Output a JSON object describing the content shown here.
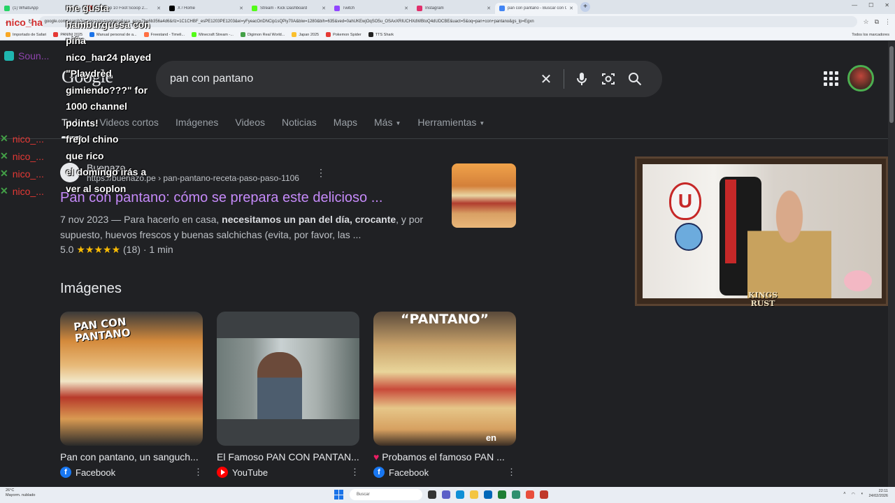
{
  "browser": {
    "tabs": [
      {
        "label": "(1) WhatsApp",
        "color": "#25d366"
      },
      {
        "label": "SNG Top 10 Foot Scoop 2...",
        "color": "#e53935"
      },
      {
        "label": "X / Home",
        "color": "#000000"
      },
      {
        "label": "Stream - Kick Dashboard",
        "color": "#53fc18"
      },
      {
        "label": "Twitch",
        "color": "#9146ff"
      },
      {
        "label": "Instagram",
        "color": "#e1306c"
      },
      {
        "label": "pan con pantano - Buscar con G",
        "color": "#4285f4",
        "active": true
      }
    ],
    "url": "google.com/search?q=pan+con+pantano&sca_esv=7be6b356a4d6&rlz=1C1CHBF_esPE1203PE1203&ei=yFyeacOnDNCip1sQPiy70A&biw=1280&bih=635&ved=0ahUKEwjOqSO5u_OSAxXRIUCHXdWBtoQ4dUDCBE&uact=5&oq=pan+con+pantano&gs_lp=Egxn",
    "bookmarks": [
      {
        "label": "Importado de Safari",
        "color": "#f9a825"
      },
      {
        "label": "PANINI 2025",
        "color": "#e53935"
      },
      {
        "label": "Manual personal de a...",
        "color": "#1a73e8"
      },
      {
        "label": "Freestand - Timeli...",
        "color": "#ff7043"
      },
      {
        "label": "Minecraft Stream -...",
        "color": "#53fc18"
      },
      {
        "label": "Digimon Real World...",
        "color": "#43a047"
      },
      {
        "label": "Japan 2025",
        "color": "#fbc02d"
      },
      {
        "label": "Pokemon Spider",
        "color": "#e53935"
      },
      {
        "label": "TTS Shark",
        "color": "#212121"
      }
    ],
    "all_bookmarks": "Todos los marcadores"
  },
  "google": {
    "logo": "Google",
    "query": "pan con pantano",
    "tabs": [
      {
        "label": "Todo",
        "active": true
      },
      {
        "label": "Videos cortos"
      },
      {
        "label": "Imágenes"
      },
      {
        "label": "Videos"
      },
      {
        "label": "Noticias"
      },
      {
        "label": "Maps"
      },
      {
        "label": "Más",
        "dropdown": true
      },
      {
        "label": "Herramientas",
        "dropdown": true
      }
    ],
    "result": {
      "site": "Buenazo",
      "url": "https://buenazo.pe › pan-pantano-receta-paso-paso-1106",
      "title": "Pan con pantano: cómo se prepara este delicioso ...",
      "date": "7 nov 2023",
      "snippet_pre": " — Para hacerlo en casa, ",
      "snippet_bold": "necesitamos un pan del día, crocante",
      "snippet_post": ", y por supuesto, huevos frescos y buenas salchichas (evita, por favor, las ...",
      "rating": "5.0",
      "stars": "★★★★★",
      "reviews": "(18)",
      "duration": "· 1 min"
    },
    "images_heading": "Imágenes",
    "images": [
      {
        "caption": "Pan con pantano, un sanguch...",
        "source": "Facebook",
        "overlay": "PAN CON\nPANTANO"
      },
      {
        "caption": "El Famoso PAN CON PANTAN...",
        "source": "YouTube"
      },
      {
        "caption": "Probamos el famoso PAN ...",
        "source": "Facebook",
        "overlay": "“PANTANO”",
        "corner": "en"
      }
    ]
  },
  "stream_overlay": {
    "chat_lines": [
      "me gusta",
      "hamburguesa con",
      "piña",
      "nico_har24 played",
      "\"Playdred",
      "gimiendo???\" for",
      "1000 channel",
      "points!",
      "frejol chino",
      "que rico",
      "el domingo irás a",
      "ver al soplon"
    ],
    "sound_label": "Soun...",
    "top_name": "nico_ha",
    "strip_names": [
      "nico_...",
      "nico_...",
      "nico_...",
      "nico_..."
    ],
    "cam_brand": "KINGS\nRUST"
  },
  "taskbar": {
    "weather_temp": "26°C",
    "weather_desc": "Mayorm. nublado",
    "search_placeholder": "Buscar",
    "time": "22:11",
    "date": "24/02/2026"
  }
}
